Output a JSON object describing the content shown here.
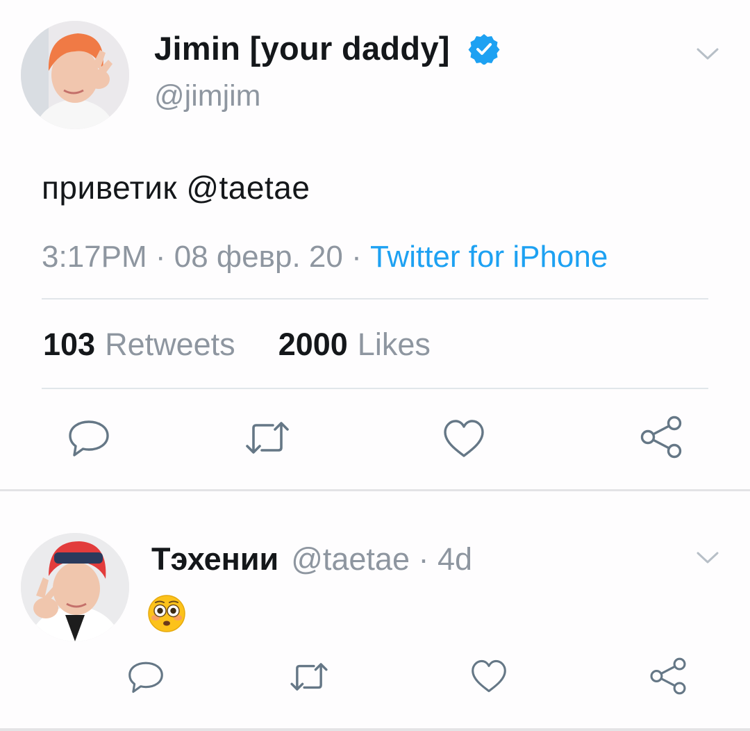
{
  "tweet": {
    "author": {
      "display_name": "Jimin [your daddy]",
      "handle": "@jimjim",
      "verified": true,
      "avatar": "profile-photo"
    },
    "text": "приветик @taetae",
    "time": "3:17PM",
    "date": "08 февр. 20",
    "source": "Twitter for iPhone",
    "separator": "·",
    "stats": {
      "retweets_count": "103",
      "retweets_label": "Retweets",
      "likes_count": "2000",
      "likes_label": "Likes"
    },
    "actions": [
      "reply-icon",
      "retweet-icon",
      "like-icon",
      "share-icon"
    ]
  },
  "reply": {
    "display_name": "Тэхении",
    "handle": "@taetae",
    "age": "4d",
    "meta": "@taetae · 4d",
    "emoji": "flushed-face",
    "actions": [
      "reply-icon",
      "retweet-icon",
      "like-icon",
      "share-icon"
    ]
  },
  "colors": {
    "link_blue": "#1da1f2",
    "muted_gray": "#8e96a0",
    "icon_gray": "#657786",
    "text": "#14171a",
    "divider": "#e1e6ea"
  }
}
